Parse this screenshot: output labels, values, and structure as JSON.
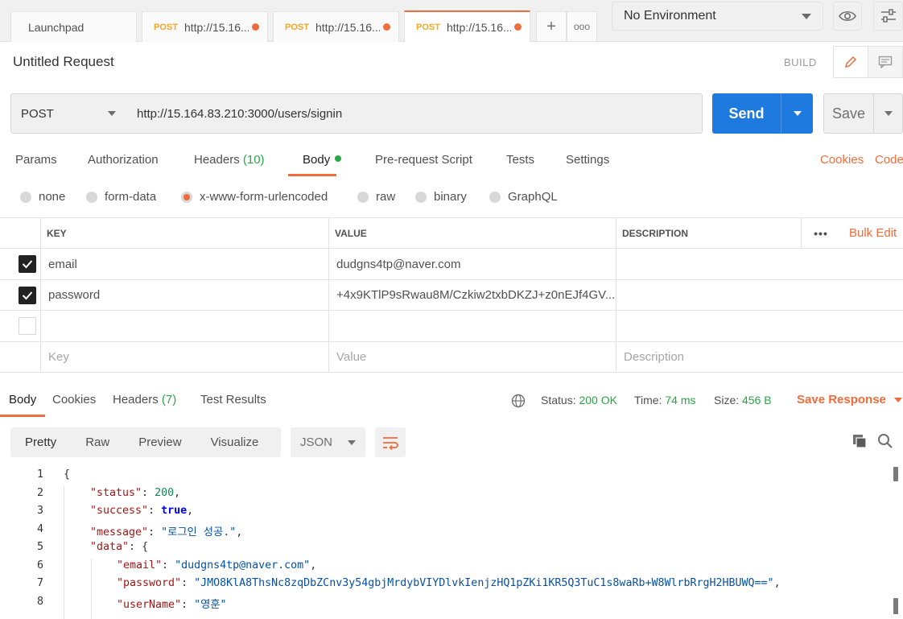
{
  "tabs": {
    "launchpad": "Launchpad",
    "items": [
      {
        "method": "POST",
        "url": "http://15.16..."
      },
      {
        "method": "POST",
        "url": "http://15.16..."
      },
      {
        "method": "POST",
        "url": "http://15.16..."
      }
    ],
    "add": "+",
    "more": "ooo"
  },
  "environment": {
    "selected": "No Environment"
  },
  "request": {
    "title": "Untitled Request",
    "build_label": "BUILD",
    "method": "POST",
    "url": "http://15.164.83.210:3000/users/signin",
    "send_label": "Send",
    "save_label": "Save"
  },
  "request_tabs": {
    "params": "Params",
    "authorization": "Authorization",
    "headers": "Headers",
    "headers_count": "(10)",
    "body": "Body",
    "prerequest": "Pre-request Script",
    "tests": "Tests",
    "settings": "Settings",
    "cookies": "Cookies",
    "code": "Code"
  },
  "body_types": {
    "none": "none",
    "form_data": "form-data",
    "urlencoded": "x-www-form-urlencoded",
    "raw": "raw",
    "binary": "binary",
    "graphql": "GraphQL",
    "selected": "x-www-form-urlencoded"
  },
  "params_table": {
    "headers": {
      "key": "KEY",
      "value": "VALUE",
      "description": "DESCRIPTION",
      "bulk_edit": "Bulk Edit",
      "more": "•••"
    },
    "rows": [
      {
        "checked": true,
        "key": "email",
        "value": "dudgns4tp@naver.com",
        "description": ""
      },
      {
        "checked": true,
        "key": "password",
        "value": "+4x9KTlP9sRwau8M/Czkiw2txbDKZJ+z0nEJf4GV...",
        "description": ""
      }
    ],
    "placeholders": {
      "key": "Key",
      "value": "Value",
      "description": "Description"
    }
  },
  "response": {
    "tabs": {
      "body": "Body",
      "cookies": "Cookies",
      "headers": "Headers",
      "headers_count": "(7)",
      "test_results": "Test Results"
    },
    "status_label": "Status:",
    "status_value": "200 OK",
    "time_label": "Time:",
    "time_value": "74 ms",
    "size_label": "Size:",
    "size_value": "456 B",
    "save_response": "Save Response",
    "views": {
      "pretty": "Pretty",
      "raw": "Raw",
      "preview": "Preview",
      "visualize": "Visualize"
    },
    "format": "JSON"
  },
  "code_lines": [
    {
      "n": "1",
      "indent": 0,
      "key": "",
      "value": "{",
      "type": "punct"
    },
    {
      "n": "2",
      "indent": 1,
      "key": "\"status\"",
      "value": "200",
      "type": "num",
      "trail": ","
    },
    {
      "n": "3",
      "indent": 1,
      "key": "\"success\"",
      "value": "true",
      "type": "bool",
      "trail": ","
    },
    {
      "n": "4",
      "indent": 1,
      "key": "\"message\"",
      "value": "\"로그인 성공.\"",
      "type": "str",
      "trail": ","
    },
    {
      "n": "5",
      "indent": 1,
      "key": "\"data\"",
      "value": "{",
      "type": "punct",
      "trail": ""
    },
    {
      "n": "6",
      "indent": 2,
      "key": "\"email\"",
      "value": "\"dudgns4tp@naver.com\"",
      "type": "str",
      "trail": ","
    },
    {
      "n": "7",
      "indent": 2,
      "key": "\"password\"",
      "value": "\"JMO8KlA8ThsNc8zqDbZCnv3y54gbjMrdybVIYDlvkIenjzHQ1pZKi1KR5Q3TuC1s8waRb+W8WlrbRrgH2HBUWQ==\"",
      "type": "str",
      "trail": ","
    },
    {
      "n": "8",
      "indent": 2,
      "key": "\"userName\"",
      "value": "\"영훈\"",
      "type": "str",
      "trail": ""
    }
  ],
  "colors": {
    "accent": "#f26b3a",
    "send": "#1f7ae0",
    "success": "#27a645",
    "method_tab": "#f5a623"
  },
  "icons": [
    "eye-icon",
    "settings-sliders-icon",
    "pencil-icon",
    "comment-icon",
    "globe-icon",
    "copy-icon",
    "search-icon",
    "wrap-lines-icon",
    "check-icon"
  ]
}
